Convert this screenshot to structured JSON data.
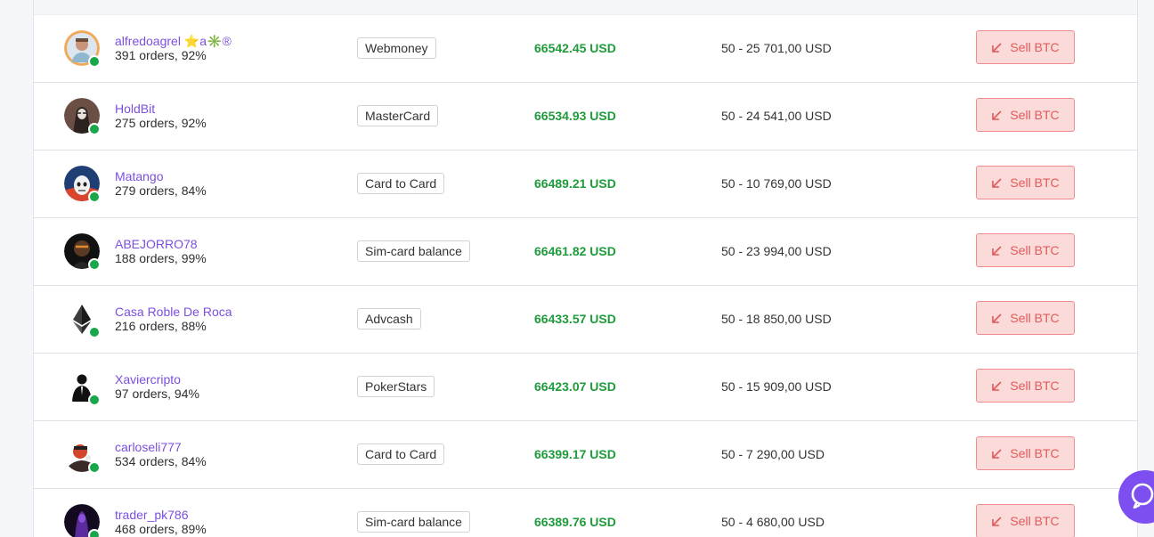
{
  "colors": {
    "name": "#7b4fe0",
    "price": "#1e9b3b",
    "sell_bg": "#fbdada",
    "sell_border": "#ef8c8c",
    "sell_text": "#e05a5a",
    "online": "#18a84b",
    "chat": "#7e4ff0"
  },
  "offers": [
    {
      "name": "alfredoagrel ⭐a✳️®",
      "stats": "391 orders, 92%",
      "method": "Webmoney",
      "price": "66542.45 USD",
      "limits": "50 - 25 701,00 USD",
      "action": "Sell BTC",
      "avatar_icon": "man-portrait-icon"
    },
    {
      "name": "HoldBit",
      "stats": "275 orders, 92%",
      "method": "MasterCard",
      "price": "66534.93 USD",
      "limits": "50 - 24 541,00 USD",
      "action": "Sell BTC",
      "avatar_icon": "masked-figure-icon"
    },
    {
      "name": "Matango",
      "stats": "279 orders, 84%",
      "method": "Card to Card",
      "price": "66489.21 USD",
      "limits": "50 - 10 769,00 USD",
      "action": "Sell BTC",
      "avatar_icon": "stormtrooper-icon"
    },
    {
      "name": "ABEJORRO78",
      "stats": "188 orders, 99%",
      "method": "Sim-card balance",
      "price": "66461.82 USD",
      "limits": "50 - 23 994,00 USD",
      "action": "Sell BTC",
      "avatar_icon": "dark-helmet-icon"
    },
    {
      "name": "Casa Roble De Roca",
      "stats": "216 orders, 88%",
      "method": "Advcash",
      "price": "66433.57 USD",
      "limits": "50 - 18 850,00 USD",
      "action": "Sell BTC",
      "avatar_icon": "ethereum-logo-icon"
    },
    {
      "name": "Xaviercripto",
      "stats": "97 orders, 94%",
      "method": "PokerStars",
      "price": "66423.07 USD",
      "limits": "50 - 15 909,00 USD",
      "action": "Sell BTC",
      "avatar_icon": "businessman-silhouette-icon"
    },
    {
      "name": "carloseli777",
      "stats": "534 orders, 84%",
      "method": "Card to Card",
      "price": "66399.17 USD",
      "limits": "50 - 7 290,00 USD",
      "action": "Sell BTC",
      "avatar_icon": "cartoon-character-icon"
    },
    {
      "name": "trader_pk786",
      "stats": "468 orders, 89%",
      "method": "Sim-card balance",
      "price": "66389.76 USD",
      "limits": "50 - 4 680,00 USD",
      "action": "Sell BTC",
      "avatar_icon": "purple-figure-icon"
    }
  ],
  "chat_widget": {
    "icon": "chat-icon"
  }
}
